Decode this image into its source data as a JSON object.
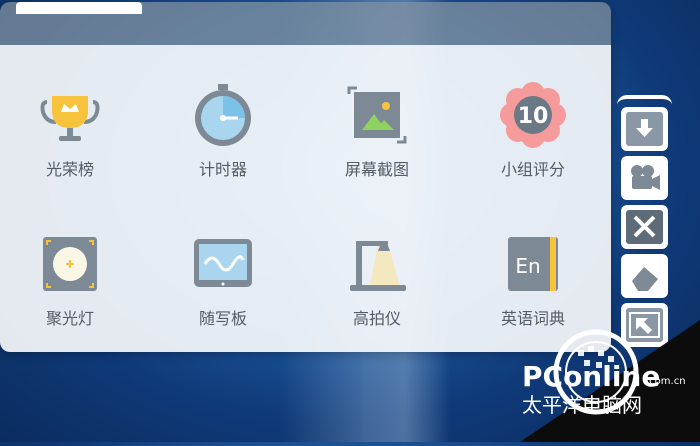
{
  "colors": {
    "panel_header": "#7d8e9e",
    "panel_body": "#f5f7fa",
    "label_text": "#555c63",
    "sidebar_active": "#5e6b79"
  },
  "tools": [
    {
      "label": "光荣榜",
      "icon": "trophy-icon"
    },
    {
      "label": "计时器",
      "icon": "stopwatch-icon"
    },
    {
      "label": "屏幕截图",
      "icon": "screenshot-icon"
    },
    {
      "label": "小组评分",
      "icon": "score-flower-icon",
      "badge": "10"
    },
    {
      "label": "聚光灯",
      "icon": "spotlight-icon"
    },
    {
      "label": "随写板",
      "icon": "writing-board-icon"
    },
    {
      "label": "高拍仪",
      "icon": "document-camera-icon"
    },
    {
      "label": "英语词典",
      "icon": "dictionary-icon",
      "badge": "En"
    }
  ],
  "sidebar": {
    "buttons": [
      {
        "icon": "download-icon"
      },
      {
        "icon": "video-camera-icon"
      },
      {
        "icon": "tools-icon",
        "active": true
      },
      {
        "icon": "eraser-icon"
      },
      {
        "icon": "window-arrow-icon"
      }
    ]
  },
  "watermark": {
    "brand": "PConline",
    "suffix": ".com.cn",
    "chinese": "太平洋电脑网"
  }
}
